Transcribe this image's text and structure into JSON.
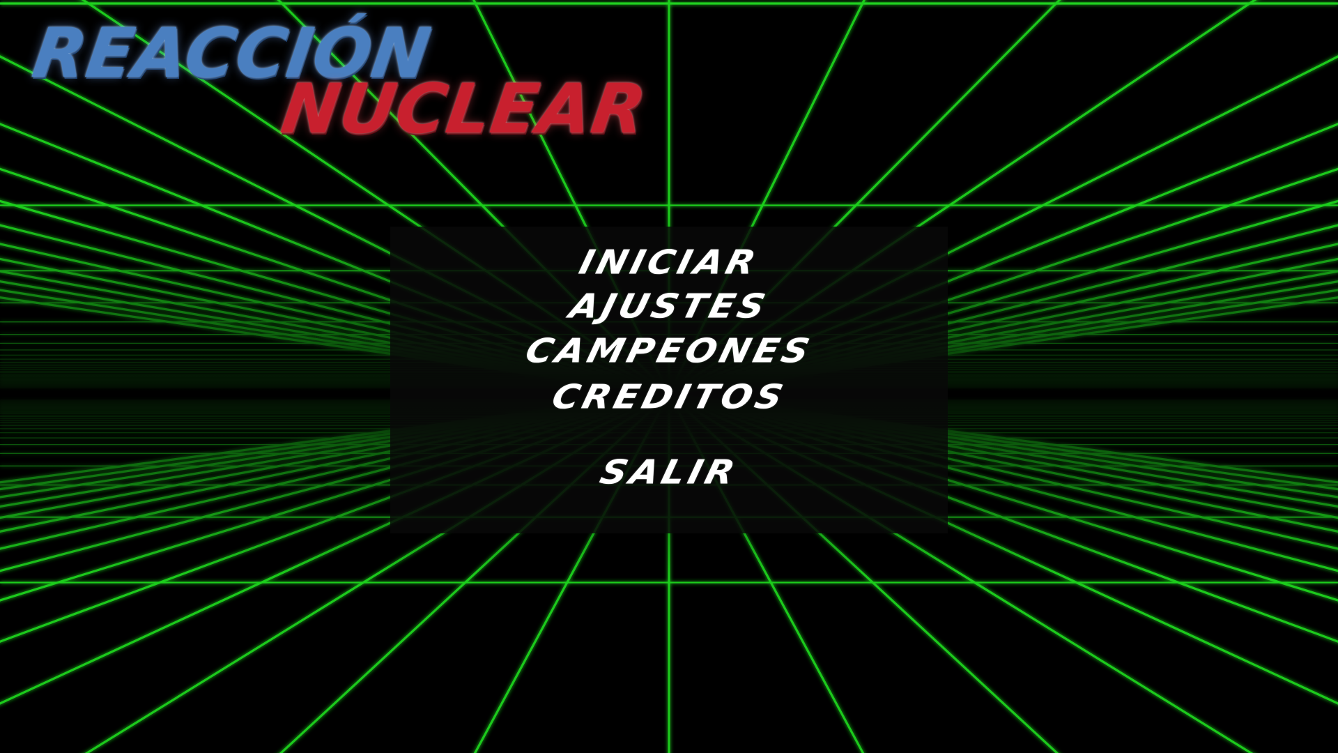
{
  "title": {
    "line1": "REACCIÓN",
    "line2": "NUCLEAR"
  },
  "menu": {
    "items": [
      {
        "label": "INICIAR"
      },
      {
        "label": "AJUSTES"
      },
      {
        "label": "CAMPEONES"
      },
      {
        "label": "CREDITOS"
      },
      {
        "label": "SALIR"
      }
    ]
  },
  "colors": {
    "grid_line": "#1fd11f",
    "background": "#000000",
    "title_line1": "#4a7fc0",
    "title_line2": "#c8202e",
    "menu_text": "#ffffff",
    "menu_panel": "#080808"
  }
}
